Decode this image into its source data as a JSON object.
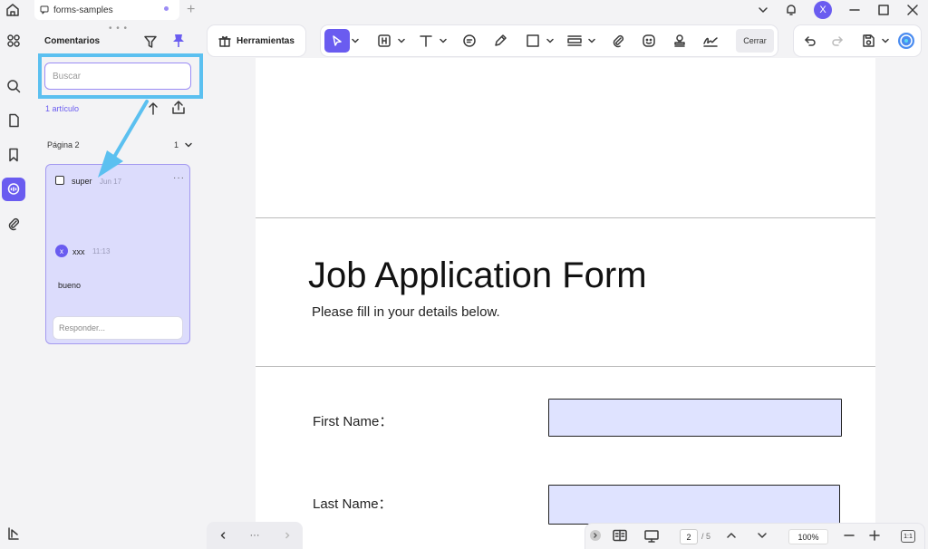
{
  "titlebar": {
    "tab_label": "forms-samples",
    "avatar_initial": "X"
  },
  "rail": {
    "items": [
      "thumbnails",
      "search",
      "pages",
      "bookmarks",
      "comments",
      "attachments",
      "layers"
    ]
  },
  "panel": {
    "title": "Comentarios",
    "search_placeholder": "Buscar",
    "count": "1 artículo",
    "page_label": "Página 2",
    "page_count": "1",
    "comment": {
      "author": "super",
      "date": "Jun 17",
      "more": "···",
      "reply": {
        "avatar": "x",
        "user": "xxx",
        "time": "11:13",
        "text": "bueno"
      },
      "reply_placeholder": "Responder..."
    }
  },
  "toolbar": {
    "tools_label": "Herramientas",
    "close_label": "Cerrar"
  },
  "document": {
    "title": "Job Application Form",
    "subtitle": "Please fill in your details below.",
    "fields": [
      {
        "label": "First Name："
      },
      {
        "label": "Last Name："
      }
    ]
  },
  "statusbar": {
    "current_page": "2",
    "total_pages": "/ 5",
    "zoom": "100%",
    "fit_label": "1:1"
  },
  "navbar": {
    "more": "···"
  },
  "colors": {
    "accent": "#6a5cf0",
    "highlight": "#5bc0f0",
    "field_fill": "#dfe3ff",
    "card_fill": "#dcdcfc"
  }
}
